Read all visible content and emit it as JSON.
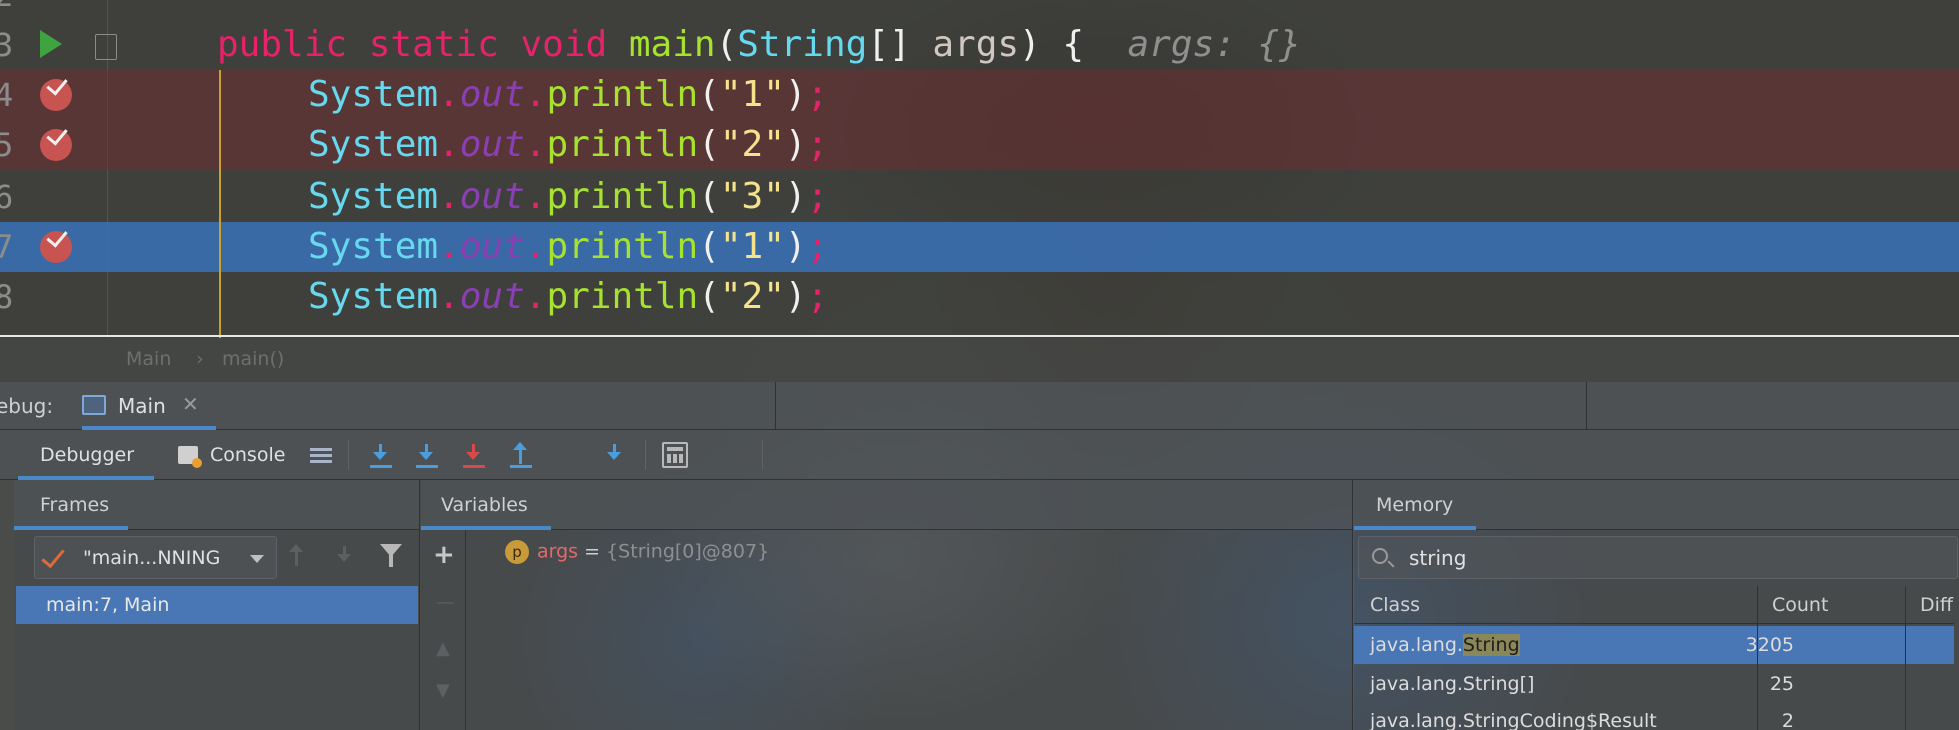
{
  "editor": {
    "lines": [
      {
        "num": "2"
      },
      {
        "num": "3",
        "tokens": [
          "public",
          "static",
          "void",
          "main",
          "(",
          "String",
          "[]",
          "args",
          ")",
          "{"
        ],
        "hint": "args: {}"
      },
      {
        "num": "4",
        "obj": "System",
        "field": "out",
        "method": "println",
        "arg": "\"1\""
      },
      {
        "num": "5",
        "obj": "System",
        "field": "out",
        "method": "println",
        "arg": "\"2\""
      },
      {
        "num": "6",
        "obj": "System",
        "field": "out",
        "method": "println",
        "arg": "\"3\""
      },
      {
        "num": "7",
        "obj": "System",
        "field": "out",
        "method": "println",
        "arg": "\"1\""
      },
      {
        "num": "8",
        "obj": "System",
        "field": "out",
        "method": "println",
        "arg": "\"2\""
      }
    ],
    "breakpoint_lines": [
      "4",
      "5",
      "7"
    ],
    "current_line": "7"
  },
  "breadcrumb": {
    "items": [
      "Main",
      "main()"
    ],
    "separator": "›"
  },
  "debug": {
    "label": "ebug:",
    "run_tab": {
      "label": "Main",
      "close": "✕"
    },
    "toolbar": {
      "debugger_tab": "Debugger",
      "console_tab": "Console"
    },
    "frames": {
      "tab": "Frames",
      "thread": "\"main...NNING",
      "rows": [
        "main:7, Main"
      ]
    },
    "variables": {
      "tab": "Variables",
      "add": "+",
      "rows": [
        {
          "badge": "p",
          "name": "args",
          "eq": " = ",
          "value": "{String[0]@807}"
        }
      ]
    },
    "memory": {
      "tab": "Memory",
      "search_value": "string",
      "columns": [
        "Class",
        "Count",
        "Diff"
      ],
      "rows": [
        {
          "prefix": "java.lang.",
          "match": "String",
          "count": "3205"
        },
        {
          "cls": "java.lang.String[]",
          "count": "25"
        },
        {
          "cls": "java.lang.StringCoding$Result",
          "count": "2"
        }
      ]
    }
  },
  "colors": {
    "keyword": "#e6226b",
    "method": "#a6e22e",
    "type": "#66d9ef",
    "string": "#f5e28c",
    "field": "#8b3fb4",
    "current_line": "#3a6eaf",
    "breakpoint": "#c75450",
    "selection": "#4a78b9"
  }
}
